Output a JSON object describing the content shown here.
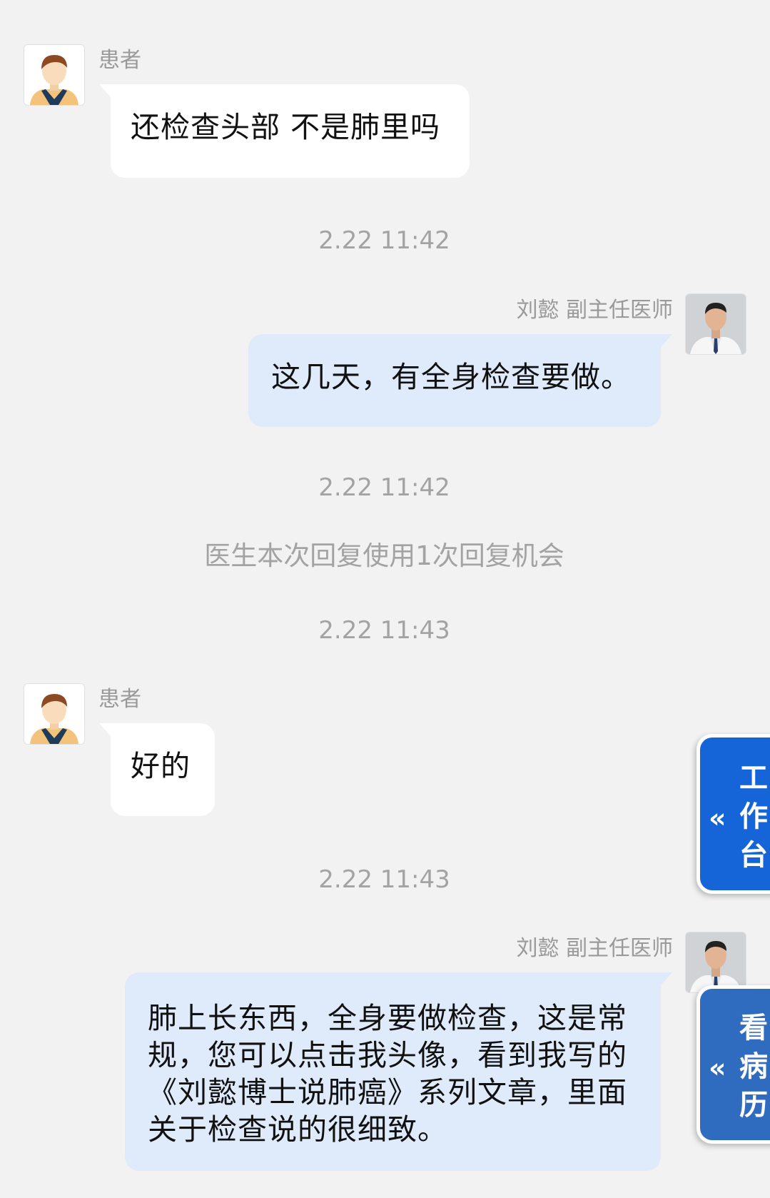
{
  "messages": [
    {
      "role": "patient",
      "sender": "患者",
      "text": "还检查头部 不是肺里吗",
      "avatar_icon": "patient-avatar-icon"
    },
    {
      "role": "doctor",
      "sender": "刘懿 副主任医师",
      "text": "这几天，有全身检查要做。",
      "avatar_icon": "doctor-avatar-icon"
    },
    {
      "role": "patient",
      "sender": "患者",
      "text": "好的",
      "avatar_icon": "patient-avatar-icon"
    },
    {
      "role": "doctor",
      "sender": "刘懿 副主任医师",
      "text": "肺上长东西，全身要做检查，这是常规，您可以点击我头像，看到我写的《刘懿博士说肺癌》系列文章，里面关于检查说的很细致。",
      "avatar_icon": "doctor-avatar-icon"
    }
  ],
  "timestamps": [
    "2.22 11:42",
    "2.22 11:42",
    "2.22 11:43",
    "2.22 11:43"
  ],
  "system_note": "医生本次回复使用1次回复机会",
  "floating_buttons": {
    "workbench": {
      "chevron": "«",
      "label": "工作台",
      "color": "#1565d8"
    },
    "records": {
      "chevron": "«",
      "label": "看病历",
      "color": "#2f6bbf"
    }
  },
  "colors": {
    "background": "#f2f2f2",
    "patient_bubble": "#ffffff",
    "doctor_bubble": "#dfeafb",
    "muted_text": "#a3a3a3"
  }
}
